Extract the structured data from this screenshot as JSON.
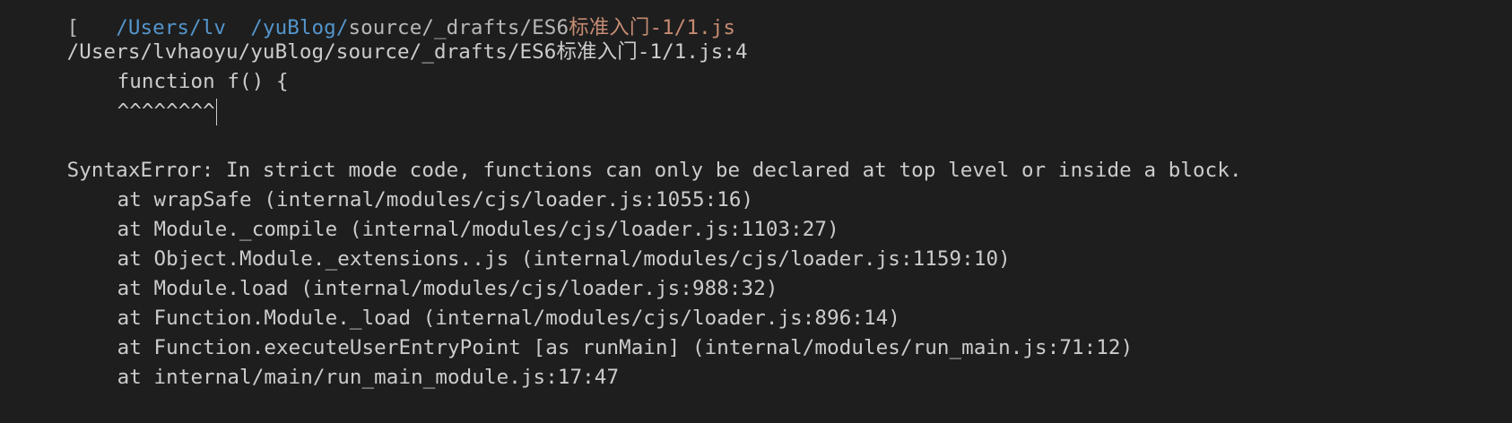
{
  "terminal": {
    "cutoff_line": {
      "prefix": "[",
      "blue_part": "   /Users/lv  /yuBlog/",
      "gray_part": "source/_drafts/ES6",
      "orange_part": "标准入门-1/1.js",
      "suffix": ""
    },
    "file_location": "/Users/lvhaoyu/yuBlog/source/_drafts/ES6标准入门-1/1.js:4",
    "code_line": "function f() {",
    "caret_line": "^^^^^^^^",
    "error_message": "SyntaxError: In strict mode code, functions can only be declared at top level or inside a block.",
    "stack_trace": [
      "at wrapSafe (internal/modules/cjs/loader.js:1055:16)",
      "at Module._compile (internal/modules/cjs/loader.js:1103:27)",
      "at Object.Module._extensions..js (internal/modules/cjs/loader.js:1159:10)",
      "at Module.load (internal/modules/cjs/loader.js:988:32)",
      "at Function.Module._load (internal/modules/cjs/loader.js:896:14)",
      "at Function.executeUserEntryPoint [as runMain] (internal/modules/run_main.js:71:12)",
      "at internal/main/run_main_module.js:17:47"
    ]
  }
}
